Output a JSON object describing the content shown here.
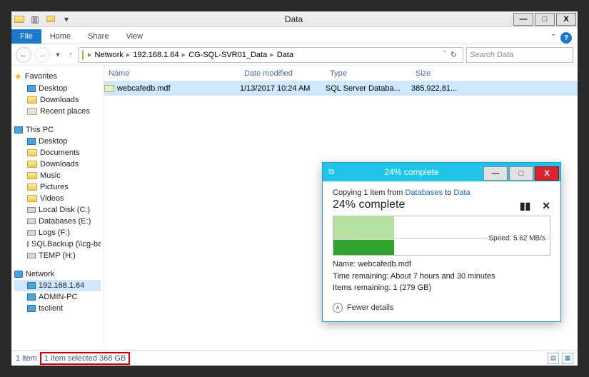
{
  "window": {
    "title": "Data",
    "min": "—",
    "max": "□",
    "close": "X"
  },
  "ribbon": {
    "file": "File",
    "home": "Home",
    "share": "Share",
    "view": "View",
    "expand": "ˇ",
    "help": "?"
  },
  "address": {
    "crumbs": [
      "Network",
      "192.168.1.64",
      "CG-SQL-SVR01_Data",
      "Data"
    ],
    "dropdown": "ˇ",
    "refresh": "↻"
  },
  "search": {
    "placeholder": "Search Data"
  },
  "columns": {
    "name": "Name",
    "date": "Date modified",
    "type": "Type",
    "size": "Size"
  },
  "files": [
    {
      "name": "webcafedb.mdf",
      "date": "1/13/2017 10:24 AM",
      "type": "SQL Server Databa...",
      "size": "385,922,81..."
    }
  ],
  "nav": {
    "favorites": {
      "label": "Favorites",
      "items": [
        "Desktop",
        "Downloads",
        "Recent places"
      ]
    },
    "thispc": {
      "label": "This PC",
      "items": [
        "Desktop",
        "Documents",
        "Downloads",
        "Music",
        "Pictures",
        "Videos",
        "Local Disk (C:)",
        "Databases (E:)",
        "Logs (F:)",
        "SQLBackup (\\\\cg-ba",
        "TEMP (H:)"
      ]
    },
    "network": {
      "label": "Network",
      "items": [
        "192.168.1.64",
        "ADMIN-PC",
        "tsclient"
      ]
    }
  },
  "status": {
    "count": "1 item",
    "selection": "1 item selected  368 GB"
  },
  "dialog": {
    "title": "24% complete",
    "min": "—",
    "max": "□",
    "close": "X",
    "copying_pre": "Copying 1 item from ",
    "copying_from": "Databases",
    "copying_mid": " to ",
    "copying_to": "Data",
    "percent": "24% complete",
    "pause": "▮▮",
    "cancel": "✕",
    "speed": "Speed: 5.62 MB/s",
    "meta_name": "Name: webcafedb.mdf",
    "meta_time": "Time remaining:  About 7 hours and 30 minutes",
    "meta_items": "Items remaining:  1 (279 GB)",
    "fewer": "Fewer details"
  }
}
